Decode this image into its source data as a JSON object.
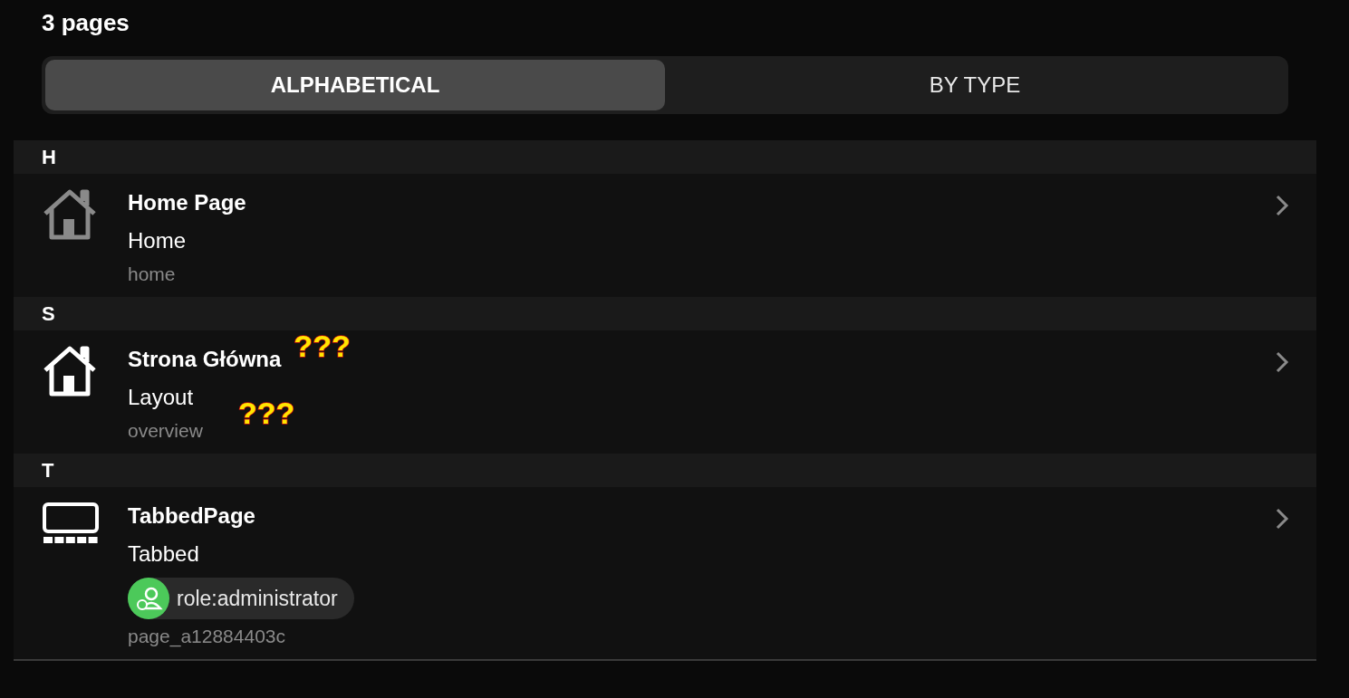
{
  "header": {
    "title": "3 pages"
  },
  "tabs": [
    {
      "label": "ALPHABETICAL",
      "selected": true
    },
    {
      "label": "BY TYPE",
      "selected": false
    }
  ],
  "sections": [
    {
      "letter": "H",
      "items": [
        {
          "kind": "house",
          "icon_dimmed": true,
          "title": "Home Page",
          "subtitle": "Home",
          "key": "home"
        }
      ]
    },
    {
      "letter": "S",
      "items": [
        {
          "kind": "house",
          "icon_dimmed": false,
          "title": "Strona Główna",
          "title_flag": "???",
          "subtitle": "Layout",
          "subtitle_flag": "???",
          "key": "overview"
        }
      ]
    },
    {
      "letter": "T",
      "items": [
        {
          "kind": "tabbed",
          "icon_dimmed": false,
          "title": "TabbedPage",
          "subtitle": "Tabbed",
          "badge": {
            "label": "role:administrator",
            "color": "#4cc95a"
          },
          "key": "page_a12884403c"
        }
      ]
    }
  ]
}
